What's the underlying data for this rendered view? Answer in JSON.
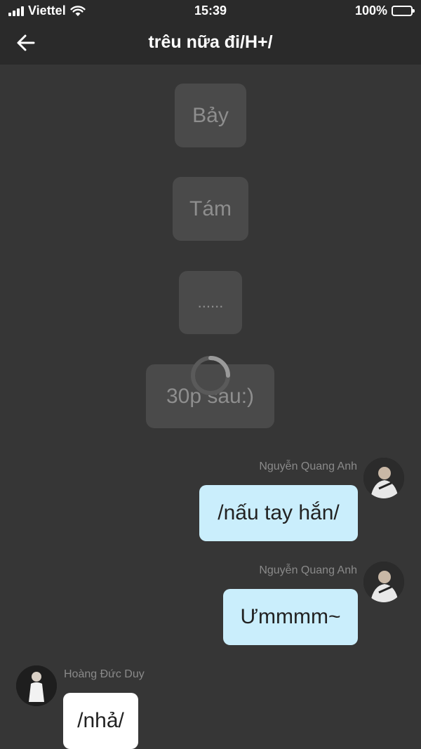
{
  "status_bar": {
    "carrier": "Viettel",
    "time": "15:39",
    "battery": "100%"
  },
  "header": {
    "title": "trêu nữa đi/H+/"
  },
  "center_messages": [
    "Bảy",
    "Tám",
    "......",
    "30p sau:)"
  ],
  "messages": [
    {
      "sender": "Nguyễn Quang Anh",
      "text": "/nấu tay hắn/"
    },
    {
      "sender": "Nguyễn Quang Anh",
      "text": "Ưmmmm~"
    },
    {
      "sender": "Hoàng Đức Duy",
      "text": "/nhả/"
    }
  ],
  "colors": {
    "background": "#363636",
    "header": "#2a2a2a",
    "outgoing_bubble": "#caeefc",
    "incoming_bubble": "#ffffff",
    "center_bubble": "#4a4a4a"
  }
}
